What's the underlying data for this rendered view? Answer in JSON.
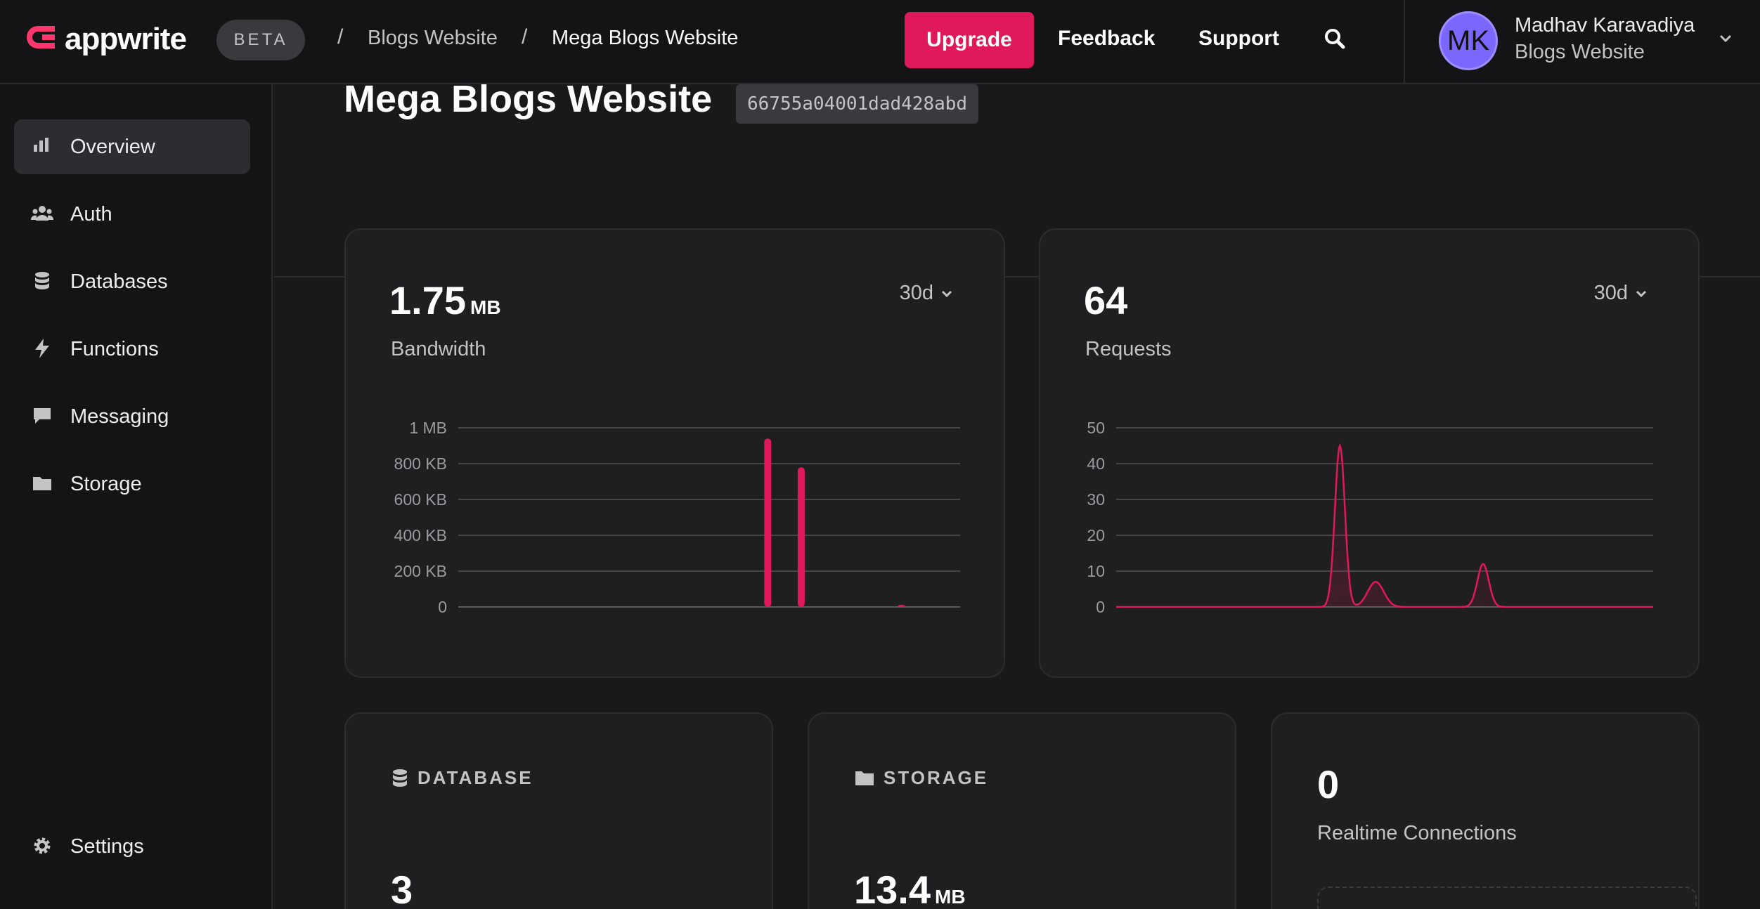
{
  "brand": {
    "name": "appwrite",
    "badge": "BETA",
    "accent": "#e0195a"
  },
  "breadcrumb": {
    "organization": "Blogs Website",
    "project": "Mega Blogs Website",
    "separator": "/"
  },
  "header": {
    "upgrade_label": "Upgrade",
    "feedback_label": "Feedback",
    "support_label": "Support",
    "user": {
      "initials": "MK",
      "name": "Madhav Karavadiya",
      "org": "Blogs Website"
    }
  },
  "sidebar": {
    "items": [
      {
        "label": "Overview",
        "icon": "bar-chart-icon",
        "active": true
      },
      {
        "label": "Auth",
        "icon": "users-icon"
      },
      {
        "label": "Databases",
        "icon": "database-icon"
      },
      {
        "label": "Functions",
        "icon": "lightning-icon"
      },
      {
        "label": "Messaging",
        "icon": "chat-bubble-icon"
      },
      {
        "label": "Storage",
        "icon": "folder-icon"
      }
    ],
    "settings_label": "Settings"
  },
  "project": {
    "title": "Mega Blogs Website",
    "id": "66755a04001dad428abd"
  },
  "bandwidth": {
    "value": "1.75",
    "unit": "MB",
    "label": "Bandwidth",
    "period": "30d"
  },
  "requests": {
    "value": "64",
    "label": "Requests",
    "period": "30d"
  },
  "database": {
    "title": "DATABASE",
    "value": "3"
  },
  "storage": {
    "title": "STORAGE",
    "value": "13.4",
    "unit": "MB"
  },
  "realtime": {
    "value": "0",
    "label": "Realtime Connections"
  },
  "chart_data": [
    {
      "type": "bar",
      "title": "Bandwidth",
      "ylabel": "",
      "xlabel": "",
      "ytick_labels": [
        "0",
        "200 KB",
        "400 KB",
        "600 KB",
        "800 KB",
        "1 MB"
      ],
      "ylim": [
        0,
        1000
      ],
      "y_unit": "KB",
      "x": [
        0,
        1,
        2,
        3,
        4,
        5,
        6,
        7,
        8,
        9,
        10,
        11,
        12,
        13,
        14,
        15,
        16,
        17,
        18,
        19,
        20,
        21,
        22,
        23,
        24,
        25,
        26,
        27,
        28,
        29
      ],
      "values": [
        0,
        0,
        0,
        0,
        0,
        0,
        0,
        0,
        0,
        0,
        0,
        0,
        0,
        0,
        0,
        0,
        0,
        0,
        940,
        0,
        780,
        0,
        0,
        0,
        0,
        0,
        2,
        0,
        0,
        0
      ],
      "grid": true,
      "color": "#e0195a"
    },
    {
      "type": "area",
      "title": "Requests",
      "ylabel": "",
      "xlabel": "",
      "ytick_labels": [
        "0",
        "10",
        "20",
        "30",
        "40",
        "50"
      ],
      "ylim": [
        0,
        50
      ],
      "x": [
        0,
        1,
        2,
        3,
        4,
        5,
        6,
        7,
        8,
        9,
        10,
        11,
        12,
        13,
        14,
        15,
        16,
        17,
        18,
        19,
        20,
        21,
        22,
        23,
        24,
        25,
        26,
        27,
        28,
        29
      ],
      "values": [
        0,
        0,
        0,
        0,
        0,
        0,
        0,
        0,
        0,
        0,
        0,
        0,
        45,
        0,
        7,
        0,
        0,
        0,
        0,
        0,
        12,
        0,
        0,
        0,
        0,
        0,
        0,
        0,
        0,
        0
      ],
      "grid": true,
      "color": "#e0195a"
    }
  ]
}
